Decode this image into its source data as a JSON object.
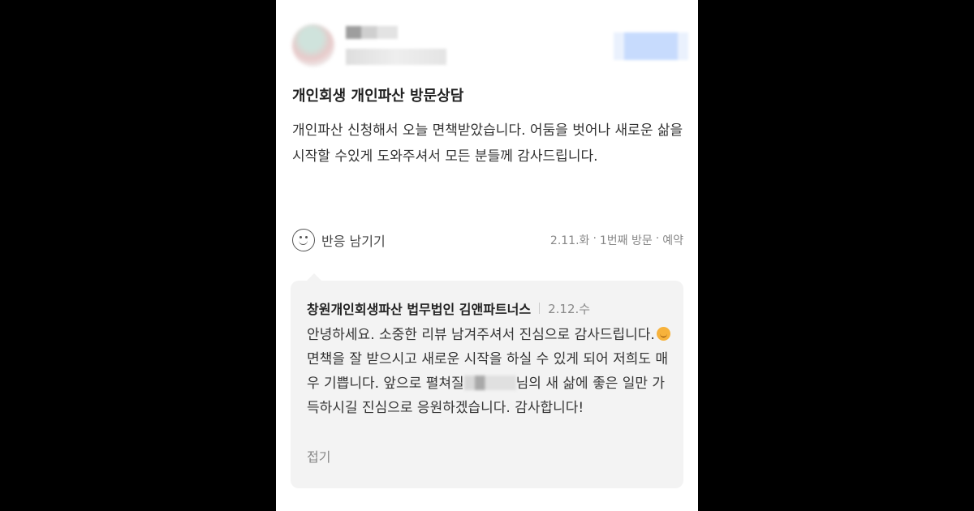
{
  "review": {
    "title": "개인회생 개인파산 방문상담",
    "body": "개인파산 신청해서 오늘 면책받았습니다. 어둠을 벗어나 새로운 삶을 시작할 수있게 도와주셔서 모든 분들께 감사드립니다.",
    "reaction_label": "반응 남기기",
    "visit": {
      "date": "2.11.화",
      "count": "1번째 방문",
      "type": "예약"
    }
  },
  "reply": {
    "author": "창원개인회생파산 법무법인 김앤파트너스",
    "date": "2.12.수",
    "line1": "안녕하세요. 소중한 리뷰 남겨주셔서 진심으로 감사드립니다.",
    "line2": "면책을 잘 받으시고 새로운 시작을 하실 수 있게 되어 저희도 매우 기쁩니다. 앞으로 펼쳐질",
    "line3": "님의 새 삶에 좋은 일만 가득하시길 진심으로 응원하겠습니다. 감사합니다!",
    "fold_label": "접기"
  },
  "icons": {
    "reaction": "smile-face-icon",
    "emoji": "smiling-face-emoji"
  }
}
